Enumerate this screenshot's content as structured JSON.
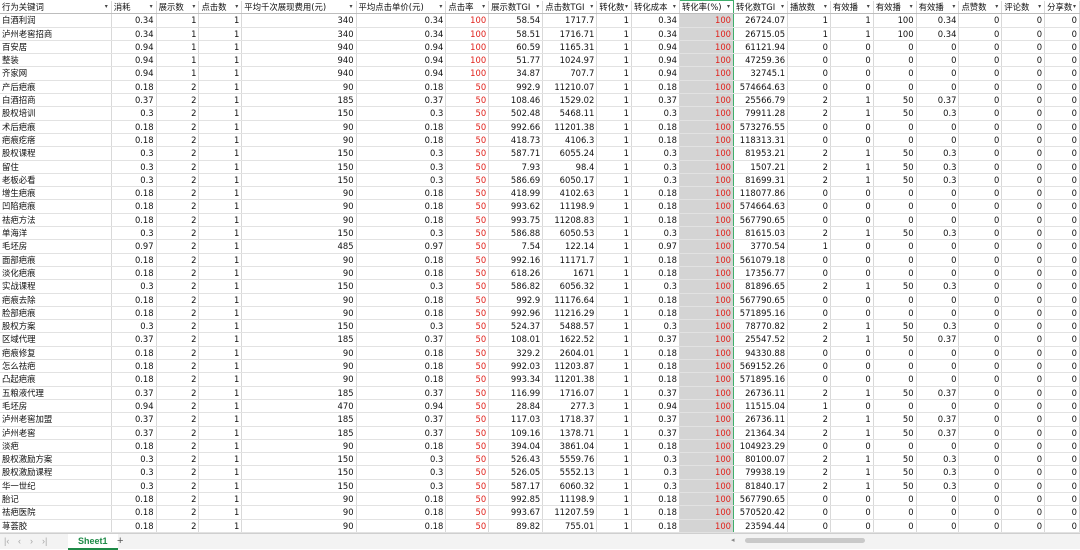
{
  "spreadsheet": {
    "headers": [
      "行为关键词",
      "消耗",
      "展示数",
      "点击数",
      "平均千次展现费用(元)",
      "平均点击单价(元)",
      "点击率",
      "展示数TGI",
      "点击数TGI",
      "转化数",
      "转化成本",
      "转化率(%)",
      "转化数TGI",
      "播放数",
      "有效播",
      "有效播",
      "有效播",
      "点赞数",
      "评论数",
      "分享数"
    ],
    "rows": [
      [
        "白酒利润",
        "0.34",
        "1",
        "1",
        "340",
        "0.34",
        "100",
        "58.54",
        "1717.7",
        "1",
        "0.34",
        "100",
        "26724.07",
        "1",
        "1",
        "100",
        "0.34",
        "0",
        "0",
        "0"
      ],
      [
        "泸州老窖招商",
        "0.34",
        "1",
        "1",
        "340",
        "0.34",
        "100",
        "58.51",
        "1716.71",
        "1",
        "0.34",
        "100",
        "26715.05",
        "1",
        "1",
        "100",
        "0.34",
        "0",
        "0",
        "0"
      ],
      [
        "百安居",
        "0.94",
        "1",
        "1",
        "940",
        "0.94",
        "100",
        "60.59",
        "1165.31",
        "1",
        "0.94",
        "100",
        "61121.94",
        "0",
        "0",
        "0",
        "0",
        "0",
        "0",
        "0"
      ],
      [
        "整装",
        "0.94",
        "1",
        "1",
        "940",
        "0.94",
        "100",
        "51.77",
        "1024.97",
        "1",
        "0.94",
        "100",
        "47259.36",
        "0",
        "0",
        "0",
        "0",
        "0",
        "0",
        "0"
      ],
      [
        "齐家网",
        "0.94",
        "1",
        "1",
        "940",
        "0.94",
        "100",
        "34.87",
        "707.7",
        "1",
        "0.94",
        "100",
        "32745.1",
        "0",
        "0",
        "0",
        "0",
        "0",
        "0",
        "0"
      ],
      [
        "产后疤痕",
        "0.18",
        "2",
        "1",
        "90",
        "0.18",
        "50",
        "992.9",
        "11210.07",
        "1",
        "0.18",
        "100",
        "574664.63",
        "0",
        "0",
        "0",
        "0",
        "0",
        "0",
        "0"
      ],
      [
        "白酒招商",
        "0.37",
        "2",
        "1",
        "185",
        "0.37",
        "50",
        "108.46",
        "1529.02",
        "1",
        "0.37",
        "100",
        "25566.79",
        "2",
        "1",
        "50",
        "0.37",
        "0",
        "0",
        "0"
      ],
      [
        "股权培训",
        "0.3",
        "2",
        "1",
        "150",
        "0.3",
        "50",
        "502.48",
        "5468.11",
        "1",
        "0.3",
        "100",
        "79911.28",
        "2",
        "1",
        "50",
        "0.3",
        "0",
        "0",
        "0"
      ],
      [
        "术后疤痕",
        "0.18",
        "2",
        "1",
        "90",
        "0.18",
        "50",
        "992.66",
        "11201.38",
        "1",
        "0.18",
        "100",
        "573276.55",
        "0",
        "0",
        "0",
        "0",
        "0",
        "0",
        "0"
      ],
      [
        "疤痕疙瘩",
        "0.18",
        "2",
        "1",
        "90",
        "0.18",
        "50",
        "418.73",
        "4106.3",
        "1",
        "0.18",
        "100",
        "118313.31",
        "0",
        "0",
        "0",
        "0",
        "0",
        "0",
        "0"
      ],
      [
        "股权课程",
        "0.3",
        "2",
        "1",
        "150",
        "0.3",
        "50",
        "587.71",
        "6055.24",
        "1",
        "0.3",
        "100",
        "81953.21",
        "2",
        "1",
        "50",
        "0.3",
        "0",
        "0",
        "0"
      ],
      [
        "留住",
        "0.3",
        "2",
        "1",
        "150",
        "0.3",
        "50",
        "7.93",
        "98.4",
        "1",
        "0.3",
        "100",
        "1507.21",
        "2",
        "1",
        "50",
        "0.3",
        "0",
        "0",
        "0"
      ],
      [
        "老板必看",
        "0.3",
        "2",
        "1",
        "150",
        "0.3",
        "50",
        "586.69",
        "6050.17",
        "1",
        "0.3",
        "100",
        "81699.31",
        "2",
        "1",
        "50",
        "0.3",
        "0",
        "0",
        "0"
      ],
      [
        "增生疤痕",
        "0.18",
        "2",
        "1",
        "90",
        "0.18",
        "50",
        "418.99",
        "4102.63",
        "1",
        "0.18",
        "100",
        "118077.86",
        "0",
        "0",
        "0",
        "0",
        "0",
        "0",
        "0"
      ],
      [
        "凹陷疤痕",
        "0.18",
        "2",
        "1",
        "90",
        "0.18",
        "50",
        "993.62",
        "11198.9",
        "1",
        "0.18",
        "100",
        "574664.63",
        "0",
        "0",
        "0",
        "0",
        "0",
        "0",
        "0"
      ],
      [
        "祛疤方法",
        "0.18",
        "2",
        "1",
        "90",
        "0.18",
        "50",
        "993.75",
        "11208.83",
        "1",
        "0.18",
        "100",
        "567790.65",
        "0",
        "0",
        "0",
        "0",
        "0",
        "0",
        "0"
      ],
      [
        "单海洋",
        "0.3",
        "2",
        "1",
        "150",
        "0.3",
        "50",
        "586.88",
        "6050.53",
        "1",
        "0.3",
        "100",
        "81615.03",
        "2",
        "1",
        "50",
        "0.3",
        "0",
        "0",
        "0"
      ],
      [
        "毛坯房",
        "0.97",
        "2",
        "1",
        "485",
        "0.97",
        "50",
        "7.54",
        "122.14",
        "1",
        "0.97",
        "100",
        "3770.54",
        "1",
        "0",
        "0",
        "0",
        "0",
        "0",
        "0"
      ],
      [
        "面部疤痕",
        "0.18",
        "2",
        "1",
        "90",
        "0.18",
        "50",
        "992.16",
        "11171.7",
        "1",
        "0.18",
        "100",
        "561079.18",
        "0",
        "0",
        "0",
        "0",
        "0",
        "0",
        "0"
      ],
      [
        "淡化疤痕",
        "0.18",
        "2",
        "1",
        "90",
        "0.18",
        "50",
        "618.26",
        "1671",
        "1",
        "0.18",
        "100",
        "17356.77",
        "0",
        "0",
        "0",
        "0",
        "0",
        "0",
        "0"
      ],
      [
        "实战课程",
        "0.3",
        "2",
        "1",
        "150",
        "0.3",
        "50",
        "586.82",
        "6056.32",
        "1",
        "0.3",
        "100",
        "81896.65",
        "2",
        "1",
        "50",
        "0.3",
        "0",
        "0",
        "0"
      ],
      [
        "疤痕去除",
        "0.18",
        "2",
        "1",
        "90",
        "0.18",
        "50",
        "992.9",
        "11176.64",
        "1",
        "0.18",
        "100",
        "567790.65",
        "0",
        "0",
        "0",
        "0",
        "0",
        "0",
        "0"
      ],
      [
        "脸部疤痕",
        "0.18",
        "2",
        "1",
        "90",
        "0.18",
        "50",
        "992.96",
        "11216.29",
        "1",
        "0.18",
        "100",
        "571895.16",
        "0",
        "0",
        "0",
        "0",
        "0",
        "0",
        "0"
      ],
      [
        "股权方案",
        "0.3",
        "2",
        "1",
        "150",
        "0.3",
        "50",
        "524.37",
        "5488.57",
        "1",
        "0.3",
        "100",
        "78770.82",
        "2",
        "1",
        "50",
        "0.3",
        "0",
        "0",
        "0"
      ],
      [
        "区域代理",
        "0.37",
        "2",
        "1",
        "185",
        "0.37",
        "50",
        "108.01",
        "1622.52",
        "1",
        "0.37",
        "100",
        "25547.52",
        "2",
        "1",
        "50",
        "0.37",
        "0",
        "0",
        "0"
      ],
      [
        "疤痕修复",
        "0.18",
        "2",
        "1",
        "90",
        "0.18",
        "50",
        "329.2",
        "2604.01",
        "1",
        "0.18",
        "100",
        "94330.88",
        "0",
        "0",
        "0",
        "0",
        "0",
        "0",
        "0"
      ],
      [
        "怎么祛疤",
        "0.18",
        "2",
        "1",
        "90",
        "0.18",
        "50",
        "992.03",
        "11203.87",
        "1",
        "0.18",
        "100",
        "569152.26",
        "0",
        "0",
        "0",
        "0",
        "0",
        "0",
        "0"
      ],
      [
        "凸起疤痕",
        "0.18",
        "2",
        "1",
        "90",
        "0.18",
        "50",
        "993.34",
        "11201.38",
        "1",
        "0.18",
        "100",
        "571895.16",
        "0",
        "0",
        "0",
        "0",
        "0",
        "0",
        "0"
      ],
      [
        "五粮液代理",
        "0.37",
        "2",
        "1",
        "185",
        "0.37",
        "50",
        "116.99",
        "1716.07",
        "1",
        "0.37",
        "100",
        "26736.11",
        "2",
        "1",
        "50",
        "0.37",
        "0",
        "0",
        "0"
      ],
      [
        "毛坯房",
        "0.94",
        "2",
        "1",
        "470",
        "0.94",
        "50",
        "28.84",
        "277.3",
        "1",
        "0.94",
        "100",
        "11515.04",
        "1",
        "0",
        "0",
        "0",
        "0",
        "0",
        "0"
      ],
      [
        "泸州老窖加盟",
        "0.37",
        "2",
        "1",
        "185",
        "0.37",
        "50",
        "117.03",
        "1718.37",
        "1",
        "0.37",
        "100",
        "26736.11",
        "2",
        "1",
        "50",
        "0.37",
        "0",
        "0",
        "0"
      ],
      [
        "泸州老窖",
        "0.37",
        "2",
        "1",
        "185",
        "0.37",
        "50",
        "109.16",
        "1378.71",
        "1",
        "0.37",
        "100",
        "21364.34",
        "2",
        "1",
        "50",
        "0.37",
        "0",
        "0",
        "0"
      ],
      [
        "淡疤",
        "0.18",
        "2",
        "1",
        "90",
        "0.18",
        "50",
        "394.04",
        "3861.04",
        "1",
        "0.18",
        "100",
        "104923.29",
        "0",
        "0",
        "0",
        "0",
        "0",
        "0",
        "0"
      ],
      [
        "股权激励方案",
        "0.3",
        "2",
        "1",
        "150",
        "0.3",
        "50",
        "526.43",
        "5559.76",
        "1",
        "0.3",
        "100",
        "80100.07",
        "2",
        "1",
        "50",
        "0.3",
        "0",
        "0",
        "0"
      ],
      [
        "股权激励课程",
        "0.3",
        "2",
        "1",
        "150",
        "0.3",
        "50",
        "526.05",
        "5552.13",
        "1",
        "0.3",
        "100",
        "79938.19",
        "2",
        "1",
        "50",
        "0.3",
        "0",
        "0",
        "0"
      ],
      [
        "华一世纪",
        "0.3",
        "2",
        "1",
        "150",
        "0.3",
        "50",
        "587.17",
        "6060.32",
        "1",
        "0.3",
        "100",
        "81840.17",
        "2",
        "1",
        "50",
        "0.3",
        "0",
        "0",
        "0"
      ],
      [
        "胎记",
        "0.18",
        "2",
        "1",
        "90",
        "0.18",
        "50",
        "992.85",
        "11198.9",
        "1",
        "0.18",
        "100",
        "567790.65",
        "0",
        "0",
        "0",
        "0",
        "0",
        "0",
        "0"
      ],
      [
        "祛疤医院",
        "0.18",
        "2",
        "1",
        "90",
        "0.18",
        "50",
        "993.67",
        "11207.59",
        "1",
        "0.18",
        "100",
        "570520.42",
        "0",
        "0",
        "0",
        "0",
        "0",
        "0",
        "0"
      ],
      [
        "荨荟胶",
        "0.18",
        "2",
        "1",
        "90",
        "0.18",
        "50",
        "89.82",
        "755.01",
        "1",
        "0.18",
        "100",
        "23594.44",
        "0",
        "0",
        "0",
        "0",
        "0",
        "0",
        "0"
      ]
    ]
  },
  "sheet_tabs": {
    "active": "Sheet1",
    "add_label": "+"
  },
  "icons": {
    "filter": "filter-dropdown-icon",
    "nav": "sheet-nav-arrow-icon"
  },
  "colors": {
    "accent": "#1e8a47",
    "red_text": "#e0201a",
    "highlight_col": "#d4d4d4"
  }
}
